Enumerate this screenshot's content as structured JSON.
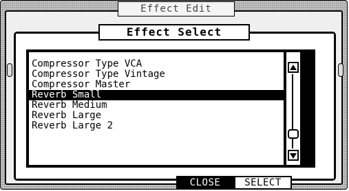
{
  "background_window": {
    "title": "Effect Edit"
  },
  "dialog": {
    "title": "Effect Select",
    "items": [
      "Compressor Type VCA",
      "Compressor Type Vintage",
      "Compressor Master",
      "Reverb Small",
      "Reverb Medium",
      "Reverb Large",
      "Reverb Large 2"
    ],
    "selected_index": 3
  },
  "buttons": {
    "close": "CLOSE",
    "select": "SELECT"
  }
}
